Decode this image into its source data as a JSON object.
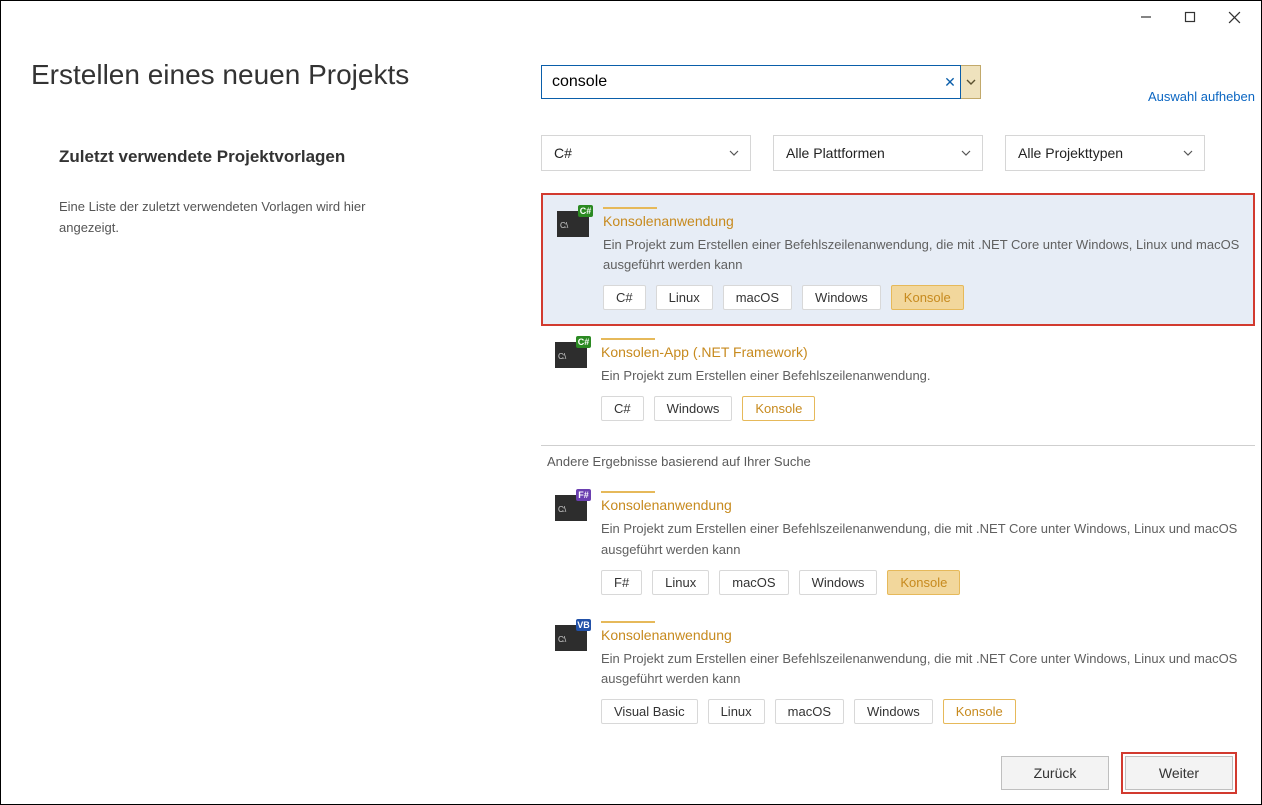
{
  "window": {
    "title": "Erstellen eines neuen Projekts"
  },
  "sidebar": {
    "recent_heading": "Zuletzt verwendete Projektvorlagen",
    "recent_empty": "Eine Liste der zuletzt verwendeten Vorlagen wird hier angezeigt."
  },
  "search": {
    "value": "console",
    "clear_all_link": "Auswahl aufheben"
  },
  "filters": {
    "language": "C#",
    "platform": "Alle Plattformen",
    "project_type": "Alle Projekttypen"
  },
  "results": {
    "other_label": "Andere Ergebnisse basierend auf Ihrer Suche",
    "primary": [
      {
        "badge": "C#",
        "name": "Konsolenanwendung",
        "desc": "Ein Projekt zum Erstellen einer Befehlszeilenanwendung, die mit .NET Core unter Windows, Linux und macOS ausgeführt werden kann",
        "tags": [
          "C#",
          "Linux",
          "macOS",
          "Windows",
          "Konsole"
        ]
      },
      {
        "badge": "C#",
        "name": "Konsolen-App (.NET Framework)",
        "desc": "Ein Projekt zum Erstellen einer Befehlszeilenanwendung.",
        "tags": [
          "C#",
          "Windows",
          "Konsole"
        ]
      }
    ],
    "other": [
      {
        "badge": "F#",
        "name": "Konsolenanwendung",
        "desc": "Ein Projekt zum Erstellen einer Befehlszeilenanwendung, die mit .NET Core unter Windows, Linux und macOS ausgeführt werden kann",
        "tags": [
          "F#",
          "Linux",
          "macOS",
          "Windows",
          "Konsole"
        ]
      },
      {
        "badge": "VB",
        "name": "Konsolenanwendung",
        "desc": "Ein Projekt zum Erstellen einer Befehlszeilenanwendung, die mit .NET Core unter Windows, Linux und macOS ausgeführt werden kann",
        "tags": [
          "Visual Basic",
          "Linux",
          "macOS",
          "Windows",
          "Konsole"
        ]
      }
    ]
  },
  "footer": {
    "back": "Zurück",
    "next": "Weiter"
  }
}
